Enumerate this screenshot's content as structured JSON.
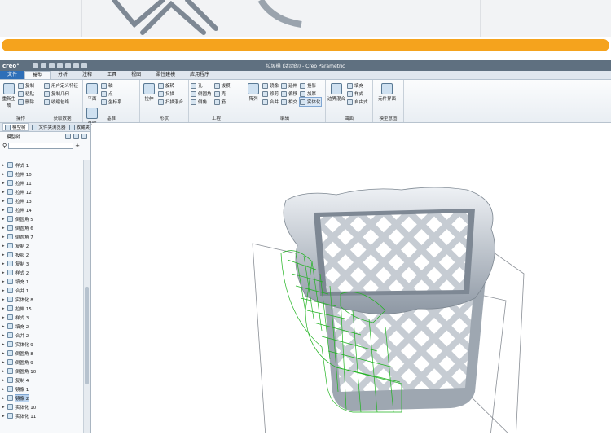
{
  "window": {
    "title": "垃圾桶 (活动的) - Creo Parametric",
    "logo": "creo°"
  },
  "tabs": [
    {
      "label": "文件"
    },
    {
      "label": "模型"
    },
    {
      "label": "分析"
    },
    {
      "label": "注释"
    },
    {
      "label": "工具"
    },
    {
      "label": "视图"
    },
    {
      "label": "柔性建模"
    },
    {
      "label": "应用程序"
    }
  ],
  "ribbon": {
    "operations": {
      "label": "操作",
      "regen": "重新生成",
      "copy": "复制",
      "paste": "粘贴",
      "delete": "删除"
    },
    "get_data": {
      "label": "获取数据",
      "udf": "用户定义特征",
      "copy_geom": "复制几何",
      "shrinkwrap": "收缩包络"
    },
    "datum": {
      "label": "基准",
      "plane": "平面",
      "axis": "轴",
      "point": "点",
      "csys": "坐标系",
      "sketch": "草绘"
    },
    "shapes": {
      "label": "形状",
      "extrude": "拉伸",
      "revolve": "旋转",
      "sweep": "扫描",
      "swept_blend": "扫描混合"
    },
    "engineering": {
      "label": "工程",
      "hole": "孔",
      "round": "倒圆角",
      "chamfer": "倒角",
      "draft": "拔模",
      "shell": "壳",
      "rib": "筋"
    },
    "editing": {
      "label": "编辑",
      "pattern": "阵列",
      "mirror": "镜像",
      "trim": "修剪",
      "merge": "合并",
      "extend": "延伸",
      "offset": "偏移",
      "intersect": "相交",
      "project": "投影",
      "thicken": "加厚",
      "solidify": "实体化"
    },
    "surfaces": {
      "label": "曲面",
      "boundary_blend": "边界混合",
      "fill": "填充",
      "style": "样式",
      "freestyle": "自由式"
    },
    "model_intent": {
      "label": "模型意图",
      "component_interface": "元件界面"
    }
  },
  "panel": {
    "tab_model_tree": "模型树",
    "tab_folder": "文件夹浏览器",
    "tab_favorites": "收藏夹",
    "tree_header": "模型树",
    "filter_placeholder": "",
    "items": [
      {
        "label": "样式 1"
      },
      {
        "label": "拉伸 10"
      },
      {
        "label": "拉伸 11"
      },
      {
        "label": "拉伸 12"
      },
      {
        "label": "拉伸 13"
      },
      {
        "label": "拉伸 14"
      },
      {
        "label": "倒圆角 5"
      },
      {
        "label": "倒圆角 6"
      },
      {
        "label": "倒圆角 7"
      },
      {
        "label": "复制 2"
      },
      {
        "label": "投影 2"
      },
      {
        "label": "复制 3"
      },
      {
        "label": "样式 2"
      },
      {
        "label": "填充 1"
      },
      {
        "label": "合并 1"
      },
      {
        "label": "实体化 8"
      },
      {
        "label": "拉伸 15"
      },
      {
        "label": "样式 3"
      },
      {
        "label": "填充 2"
      },
      {
        "label": "合并 2"
      },
      {
        "label": "实体化 9"
      },
      {
        "label": "倒圆角 8"
      },
      {
        "label": "倒圆角 9"
      },
      {
        "label": "倒圆角 10"
      },
      {
        "label": "复制 4"
      },
      {
        "label": "镜像 1"
      },
      {
        "label": "镜像 2"
      },
      {
        "label": "实体化 10"
      },
      {
        "label": "实体化 11"
      }
    ],
    "selected_index": 26
  }
}
